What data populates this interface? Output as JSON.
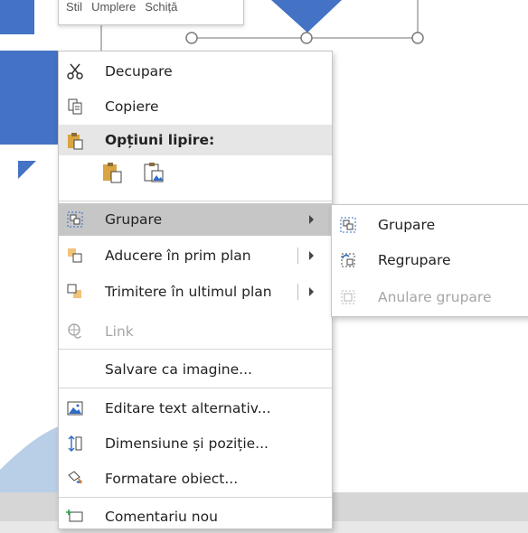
{
  "toolbar_tip": {
    "items": [
      "Stil",
      "Umplere",
      "Schiță"
    ]
  },
  "context_menu": {
    "cut_label": "Decupare",
    "copy_label": "Copiere",
    "paste_options_label": "Opțiuni lipire:",
    "group_label": "Grupare",
    "bring_front_label": "Aducere în prim plan",
    "send_back_label": "Trimitere în ultimul plan",
    "link_label": "Link",
    "save_image_label": "Salvare ca imagine...",
    "alt_text_label": "Editare text alternativ...",
    "size_position_label": "Dimensiune și poziție...",
    "format_object_label": "Formatare obiect...",
    "new_comment_label": "Comentariu nou"
  },
  "group_submenu": {
    "group_label": "Grupare",
    "regroup_label": "Regrupare",
    "ungroup_label": "Anulare grupare"
  },
  "colors": {
    "shape_blue": "#4472c4",
    "highlight": "#c6c6c6",
    "disabled_text": "#a6a6a6",
    "icon_orange": "#d9822b",
    "icon_blue": "#2e6bc6"
  }
}
